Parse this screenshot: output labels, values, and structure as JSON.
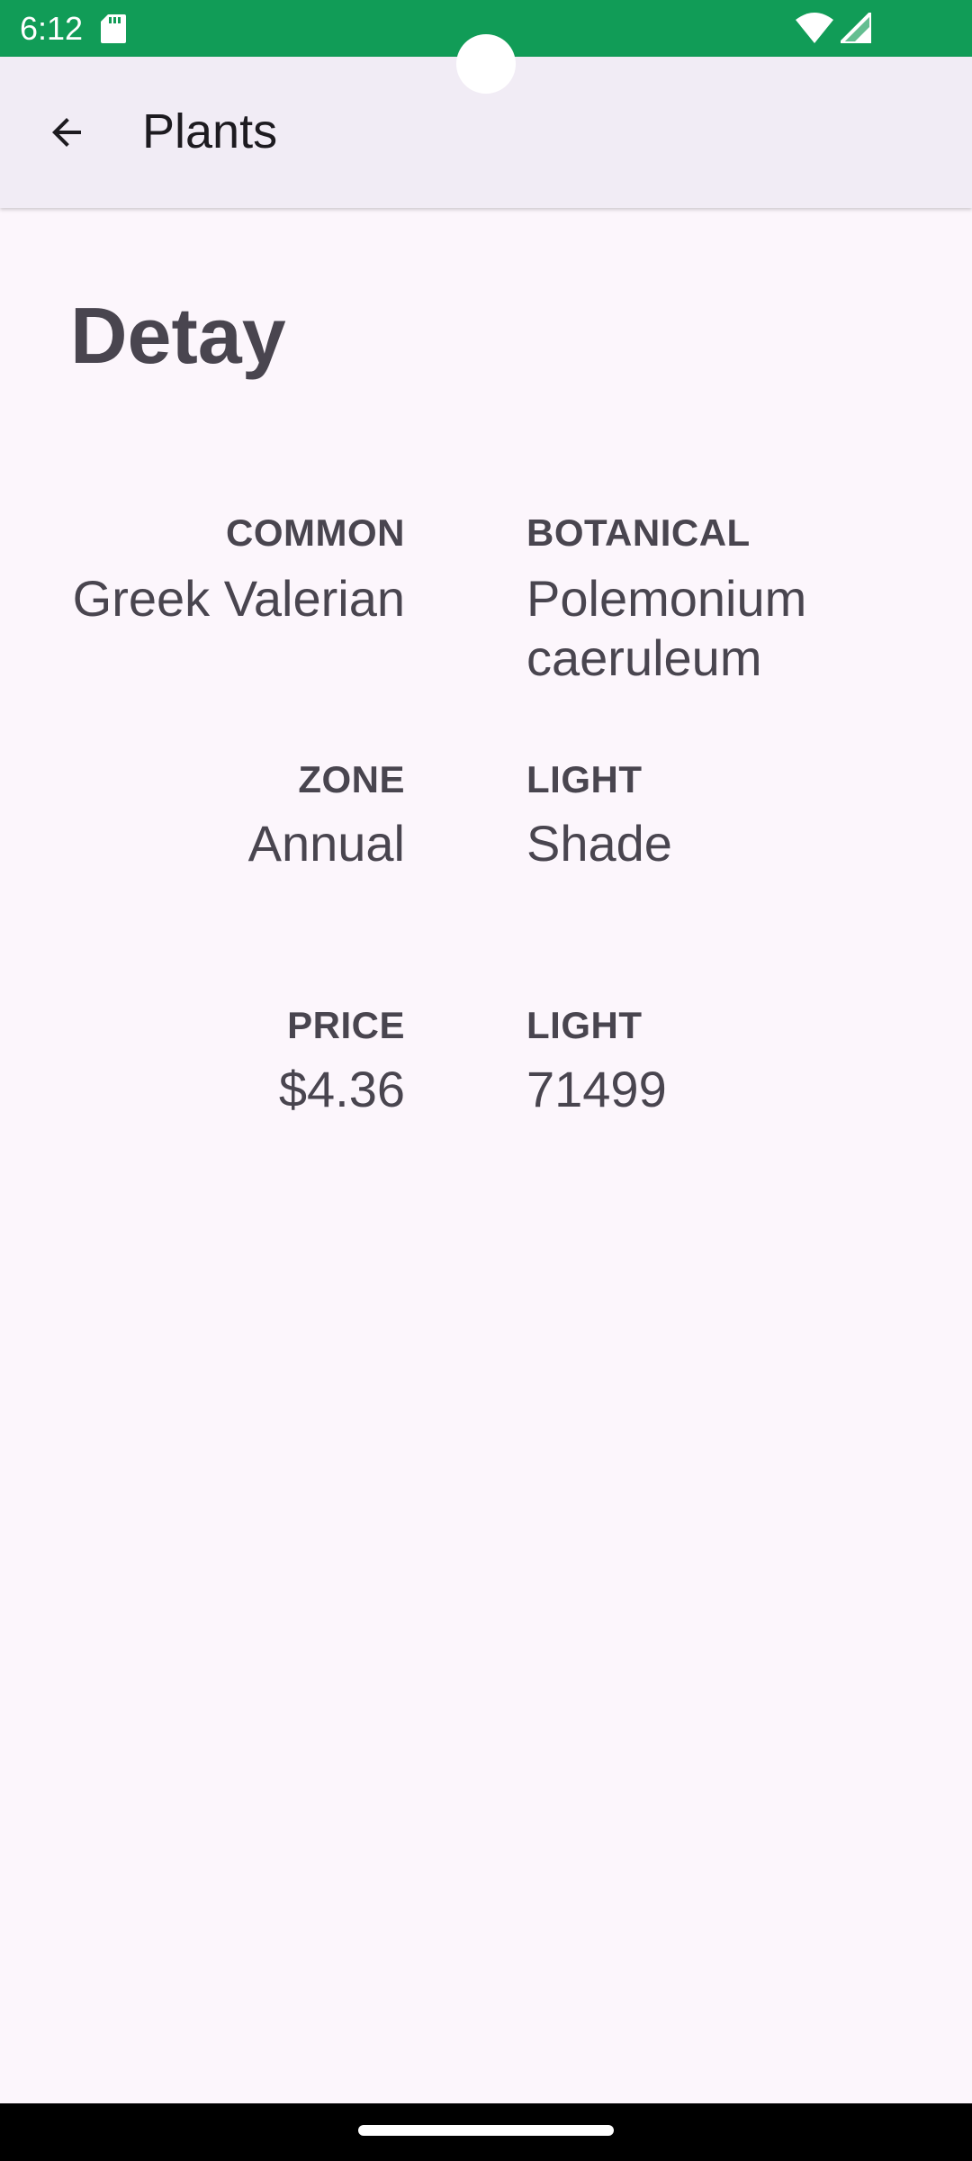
{
  "status_bar": {
    "time": "6:12",
    "background_color": "#119c57",
    "icons": [
      "sd-card-icon",
      "wifi-icon",
      "signal-icon"
    ]
  },
  "app_bar": {
    "title": "Plants",
    "back_icon": "arrow-back-icon",
    "background_color": "#f1ecf5"
  },
  "detail": {
    "heading": "Detay",
    "fields": {
      "common": {
        "label": "COMMON",
        "value": "Greek Valerian"
      },
      "botanical": {
        "label": "BOTANICAL",
        "value_line1": "Polemonium",
        "value_line2": "caeruleum"
      },
      "zone": {
        "label": "ZONE",
        "value": "Annual"
      },
      "light": {
        "label": "LIGHT",
        "value": "Shade"
      },
      "price": {
        "label": "PRICE",
        "value": "$4.36"
      },
      "light2": {
        "label": "LIGHT",
        "value": "71499"
      }
    }
  },
  "colors": {
    "page_background": "#fcf6fc",
    "text": "#49454f"
  }
}
